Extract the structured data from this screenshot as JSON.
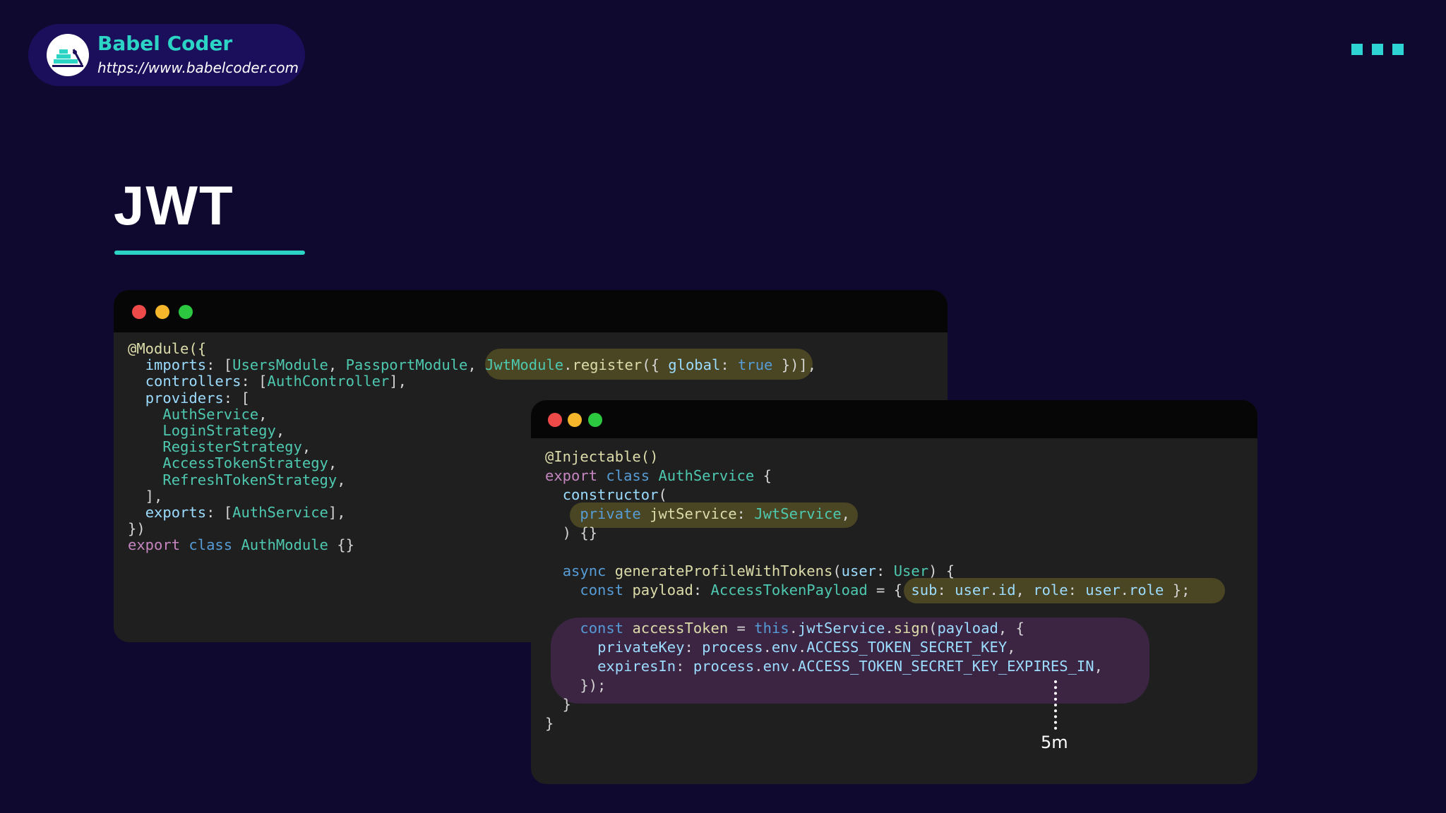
{
  "brand": {
    "name": "Babel Coder",
    "url": "https://www.babelcoder.com"
  },
  "slide": {
    "title": "JWT"
  },
  "annotation": {
    "label": "5m"
  },
  "colors": {
    "background": "#0f0930",
    "accent": "#2bd4c4",
    "pill": "#1b0f5c"
  },
  "icons": {
    "logo": "babel-coder-logo",
    "corner": "three-square-dots-icon"
  },
  "window1": {
    "lines": [
      [
        [
          "t-deco",
          "@Module({"
        ]
      ],
      [
        [
          "t-plain",
          "  "
        ],
        [
          "t-prop",
          "imports"
        ],
        [
          "t-plain",
          ": ["
        ],
        [
          "t-type",
          "UsersModule"
        ],
        [
          "t-plain",
          ", "
        ],
        [
          "t-type",
          "PassportModule"
        ],
        [
          "t-plain",
          ", "
        ],
        [
          "t-type",
          "JwtModule"
        ],
        [
          "t-plain",
          "."
        ],
        [
          "t-fn",
          "register"
        ],
        [
          "t-plain",
          "({ "
        ],
        [
          "t-prop",
          "global"
        ],
        [
          "t-plain",
          ": "
        ],
        [
          "t-bool",
          "true"
        ],
        [
          "t-plain",
          " })],"
        ]
      ],
      [
        [
          "t-plain",
          "  "
        ],
        [
          "t-prop",
          "controllers"
        ],
        [
          "t-plain",
          ": ["
        ],
        [
          "t-type",
          "AuthController"
        ],
        [
          "t-plain",
          "],"
        ]
      ],
      [
        [
          "t-plain",
          "  "
        ],
        [
          "t-prop",
          "providers"
        ],
        [
          "t-plain",
          ": ["
        ]
      ],
      [
        [
          "t-plain",
          "    "
        ],
        [
          "t-type",
          "AuthService"
        ],
        [
          "t-plain",
          ","
        ]
      ],
      [
        [
          "t-plain",
          "    "
        ],
        [
          "t-type",
          "LoginStrategy"
        ],
        [
          "t-plain",
          ","
        ]
      ],
      [
        [
          "t-plain",
          "    "
        ],
        [
          "t-type",
          "RegisterStrategy"
        ],
        [
          "t-plain",
          ","
        ]
      ],
      [
        [
          "t-plain",
          "    "
        ],
        [
          "t-type",
          "AccessTokenStrategy"
        ],
        [
          "t-plain",
          ","
        ]
      ],
      [
        [
          "t-plain",
          "    "
        ],
        [
          "t-type",
          "RefreshTokenStrategy"
        ],
        [
          "t-plain",
          ","
        ]
      ],
      [
        [
          "t-plain",
          "  ],"
        ]
      ],
      [
        [
          "t-plain",
          "  "
        ],
        [
          "t-prop",
          "exports"
        ],
        [
          "t-plain",
          ": ["
        ],
        [
          "t-type",
          "AuthService"
        ],
        [
          "t-plain",
          "],"
        ]
      ],
      [
        [
          "t-plain",
          "})"
        ]
      ],
      [
        [
          "t-kw",
          "export"
        ],
        [
          "t-plain",
          " "
        ],
        [
          "t-kw2",
          "class"
        ],
        [
          "t-plain",
          " "
        ],
        [
          "t-type",
          "AuthModule"
        ],
        [
          "t-plain",
          " {}"
        ]
      ]
    ]
  },
  "window2": {
    "lines": [
      [
        [
          "t-deco",
          "@Injectable()"
        ]
      ],
      [
        [
          "t-kw",
          "export"
        ],
        [
          "t-plain",
          " "
        ],
        [
          "t-kw2",
          "class"
        ],
        [
          "t-plain",
          " "
        ],
        [
          "t-type",
          "AuthService"
        ],
        [
          "t-plain",
          " {"
        ]
      ],
      [
        [
          "t-plain",
          "  "
        ],
        [
          "t-prop",
          "constructor"
        ],
        [
          "t-plain",
          "("
        ]
      ],
      [
        [
          "t-plain",
          "    "
        ],
        [
          "t-kw2",
          "private"
        ],
        [
          "t-plain",
          " "
        ],
        [
          "t-fn",
          "jwtService"
        ],
        [
          "t-plain",
          ": "
        ],
        [
          "t-type",
          "JwtService"
        ],
        [
          "t-plain",
          ","
        ]
      ],
      [
        [
          "t-plain",
          "  ) {}"
        ]
      ],
      [
        [
          "t-plain",
          ""
        ]
      ],
      [
        [
          "t-plain",
          "  "
        ],
        [
          "t-kw2",
          "async"
        ],
        [
          "t-plain",
          " "
        ],
        [
          "t-fn",
          "generateProfileWithTokens"
        ],
        [
          "t-plain",
          "("
        ],
        [
          "t-prop",
          "user"
        ],
        [
          "t-plain",
          ": "
        ],
        [
          "t-type",
          "User"
        ],
        [
          "t-plain",
          ") {"
        ]
      ],
      [
        [
          "t-plain",
          "    "
        ],
        [
          "t-kw2",
          "const"
        ],
        [
          "t-plain",
          " "
        ],
        [
          "t-fn",
          "payload"
        ],
        [
          "t-plain",
          ": "
        ],
        [
          "t-type",
          "AccessTokenPayload"
        ],
        [
          "t-plain",
          " = { "
        ],
        [
          "t-prop",
          "sub"
        ],
        [
          "t-plain",
          ": "
        ],
        [
          "t-prop",
          "user"
        ],
        [
          "t-plain",
          "."
        ],
        [
          "t-prop",
          "id"
        ],
        [
          "t-plain",
          ", "
        ],
        [
          "t-prop",
          "role"
        ],
        [
          "t-plain",
          ": "
        ],
        [
          "t-prop",
          "user"
        ],
        [
          "t-plain",
          "."
        ],
        [
          "t-prop",
          "role"
        ],
        [
          "t-plain",
          " };"
        ]
      ],
      [
        [
          "t-plain",
          ""
        ]
      ],
      [
        [
          "t-plain",
          "    "
        ],
        [
          "t-kw2",
          "const"
        ],
        [
          "t-plain",
          " "
        ],
        [
          "t-fn",
          "accessToken"
        ],
        [
          "t-plain",
          " = "
        ],
        [
          "t-kw2",
          "this"
        ],
        [
          "t-plain",
          "."
        ],
        [
          "t-prop",
          "jwtService"
        ],
        [
          "t-plain",
          "."
        ],
        [
          "t-fn",
          "sign"
        ],
        [
          "t-plain",
          "("
        ],
        [
          "t-prop",
          "payload"
        ],
        [
          "t-plain",
          ", {"
        ]
      ],
      [
        [
          "t-plain",
          "      "
        ],
        [
          "t-prop",
          "privateKey"
        ],
        [
          "t-plain",
          ": "
        ],
        [
          "t-prop",
          "process"
        ],
        [
          "t-plain",
          "."
        ],
        [
          "t-prop",
          "env"
        ],
        [
          "t-plain",
          "."
        ],
        [
          "t-prop",
          "ACCESS_TOKEN_SECRET_KEY"
        ],
        [
          "t-plain",
          ","
        ]
      ],
      [
        [
          "t-plain",
          "      "
        ],
        [
          "t-prop",
          "expiresIn"
        ],
        [
          "t-plain",
          ": "
        ],
        [
          "t-prop",
          "process"
        ],
        [
          "t-plain",
          "."
        ],
        [
          "t-prop",
          "env"
        ],
        [
          "t-plain",
          "."
        ],
        [
          "t-prop",
          "ACCESS_TOKEN_SECRET_KEY_EXPIRES_IN"
        ],
        [
          "t-plain",
          ","
        ]
      ],
      [
        [
          "t-plain",
          "    });"
        ]
      ],
      [
        [
          "t-plain",
          "  }"
        ]
      ],
      [
        [
          "t-plain",
          "}"
        ]
      ]
    ]
  }
}
